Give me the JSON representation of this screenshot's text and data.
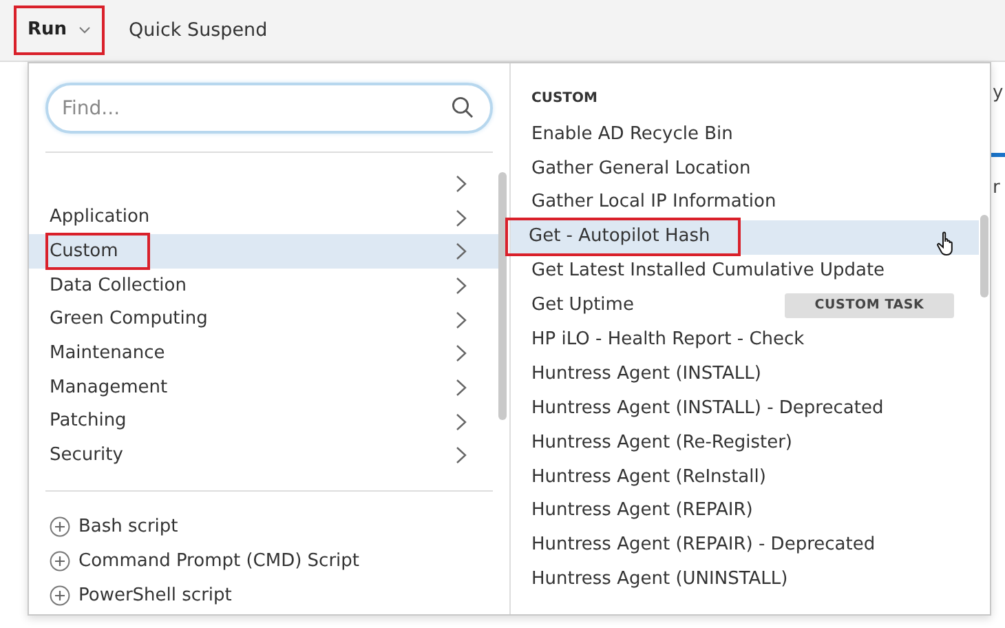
{
  "toolbar": {
    "run_button": {
      "label": "Run",
      "highlighted": true
    },
    "items": [
      "Quick Suspend"
    ]
  },
  "background_fragments": [
    "y",
    "r"
  ],
  "menu": {
    "search": {
      "placeholder": "Find..."
    },
    "categories": [
      {
        "selected": false,
        "highlighted": false
      },
      {
        "label": "Application",
        "selected": false,
        "highlighted": false
      },
      {
        "label": "Custom",
        "selected": true,
        "highlighted": true
      },
      {
        "label": "Data Collection",
        "selected": false,
        "highlighted": false
      },
      {
        "label": "Green Computing",
        "selected": false,
        "highlighted": false
      },
      {
        "label": "Maintenance",
        "selected": false,
        "highlighted": false
      },
      {
        "label": "Management",
        "selected": false,
        "highlighted": false
      },
      {
        "label": "Patching",
        "selected": false,
        "highlighted": false
      },
      {
        "label": "Security",
        "selected": false,
        "highlighted": false
      }
    ],
    "add_script": [
      "Bash script",
      "Command Prompt (CMD) Script",
      "PowerShell script"
    ],
    "section_title": "CUSTOM",
    "tasks": [
      {
        "label": "Enable AD Recycle Bin",
        "selected": false,
        "highlighted": false
      },
      {
        "label": "Gather General Location",
        "selected": false,
        "highlighted": false
      },
      {
        "label": "Gather Local IP Information",
        "selected": false,
        "highlighted": false
      },
      {
        "label": "Get - Autopilot Hash",
        "selected": true,
        "highlighted": true
      },
      {
        "label": "Get Latest Installed Cumulative Update",
        "selected": false,
        "highlighted": false
      },
      {
        "label": "Get Uptime",
        "selected": false,
        "highlighted": false,
        "badge": "CUSTOM TASK"
      },
      {
        "label": "HP iLO - Health Report - Check",
        "selected": false,
        "highlighted": false
      },
      {
        "label": "Huntress Agent (INSTALL)",
        "selected": false,
        "highlighted": false
      },
      {
        "label": "Huntress Agent (INSTALL) - Deprecated",
        "selected": false,
        "highlighted": false
      },
      {
        "label": "Huntress Agent (Re-Register)",
        "selected": false,
        "highlighted": false
      },
      {
        "label": "Huntress Agent (ReInstall)",
        "selected": false,
        "highlighted": false
      },
      {
        "label": "Huntress Agent (REPAIR)",
        "selected": false,
        "highlighted": false
      },
      {
        "label": "Huntress Agent (REPAIR) - Deprecated",
        "selected": false,
        "highlighted": false
      },
      {
        "label": "Huntress Agent (UNINSTALL)",
        "selected": false,
        "highlighted": false
      }
    ]
  }
}
